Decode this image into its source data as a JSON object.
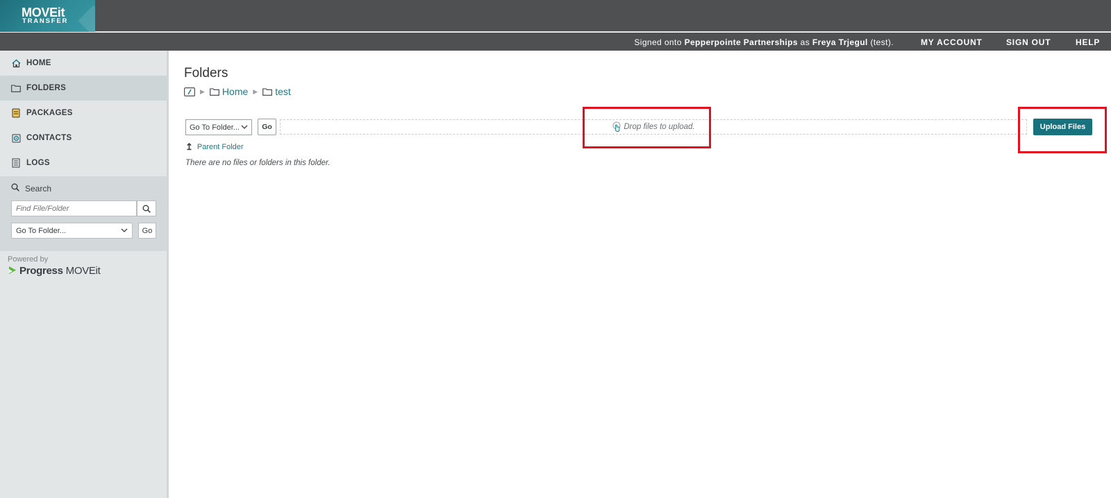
{
  "app": {
    "logo_line1": "MOVEit",
    "logo_line2": "TRANSFER"
  },
  "header": {
    "signed_prefix": "Signed onto ",
    "org": "Pepperpointe Partnerships",
    "signed_mid": " as ",
    "user": "Freya Trjegul",
    "signed_suffix": " (test).",
    "links": {
      "my_account": "MY ACCOUNT",
      "sign_out": "SIGN OUT",
      "help": "HELP"
    }
  },
  "sidebar": {
    "items": [
      {
        "label": "HOME",
        "icon": "home-icon"
      },
      {
        "label": "FOLDERS",
        "icon": "folder-icon",
        "active": true
      },
      {
        "label": "PACKAGES",
        "icon": "package-icon"
      },
      {
        "label": "CONTACTS",
        "icon": "contacts-icon"
      },
      {
        "label": "LOGS",
        "icon": "logs-icon"
      }
    ],
    "search": {
      "title": "Search",
      "placeholder": "Find File/Folder",
      "goto_value": "Go To Folder...",
      "go_label": "Go"
    },
    "powered_by": "Powered by",
    "brand_progress": "Progress",
    "brand_moveit": "MOVEit"
  },
  "main": {
    "title": "Folders",
    "breadcrumb": [
      "Home",
      "test"
    ],
    "goto_value": "Go To Folder...",
    "go_label": "Go",
    "drop_text": "Drop files to upload.",
    "upload_label": "Upload Files",
    "parent_folder": "Parent Folder",
    "empty_message": "There are no files or folders in this folder."
  },
  "colors": {
    "accent": "#17727d",
    "link": "#1c7a86",
    "highlight": "#e3101f",
    "header_bg": "#4f5052",
    "sidebar_bg": "#e2e6e7"
  }
}
